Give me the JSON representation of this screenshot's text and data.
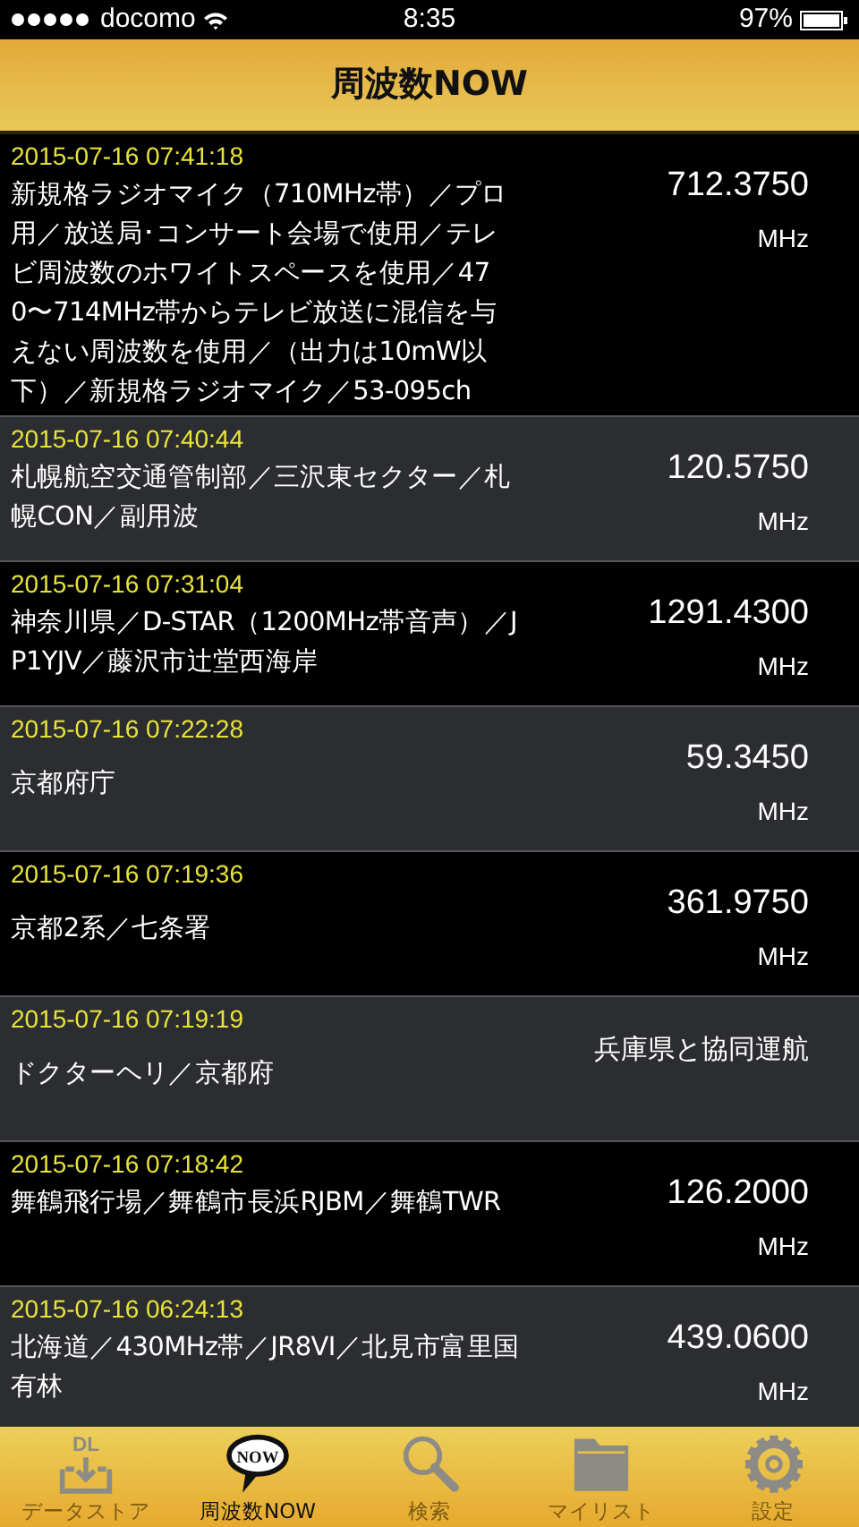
{
  "status_bar": {
    "carrier": "docomo",
    "time": "8:35",
    "battery": "97%"
  },
  "nav": {
    "title": "周波数NOW"
  },
  "entries": [
    {
      "timestamp": "2015-07-16 07:41:18",
      "description": "新規格ラジオマイク（710MHz帯）／プロ用／放送局･コンサート会場で使用／テレビ周波数のホワイトスペースを使用／470〜714MHz帯からテレビ放送に混信を与えない周波数を使用／（出力は10mW以下）／新規格ラジオマイク／53-095ch",
      "value": "712.3750",
      "unit": "MHz"
    },
    {
      "timestamp": "2015-07-16 07:40:44",
      "description": "札幌航空交通管制部／三沢東セクター／札幌CON／副用波",
      "value": "120.5750",
      "unit": "MHz"
    },
    {
      "timestamp": "2015-07-16 07:31:04",
      "description": "神奈川県／D-STAR（1200MHz帯音声）／JP1YJV／藤沢市辻堂西海岸",
      "value": "1291.4300",
      "unit": "MHz"
    },
    {
      "timestamp": "2015-07-16 07:22:28",
      "description": "京都府庁",
      "value": "59.3450",
      "unit": "MHz"
    },
    {
      "timestamp": "2015-07-16 07:19:36",
      "description": "京都2系／七条署",
      "value": "361.9750",
      "unit": "MHz"
    },
    {
      "timestamp": "2015-07-16 07:19:19",
      "description": "ドクターヘリ／京都府",
      "value": "兵庫県と協同運航"
    },
    {
      "timestamp": "2015-07-16 07:18:42",
      "description": "舞鶴飛行場／舞鶴市長浜RJBM／舞鶴TWR",
      "value": "126.2000",
      "unit": "MHz"
    },
    {
      "timestamp": "2015-07-16 06:24:13",
      "description": "北海道／430MHz帯／JR8VI／北見市富里国有林",
      "value": "439.0600",
      "unit": "MHz"
    }
  ],
  "tab_bar": [
    {
      "kind": "download",
      "icon_text": "DL",
      "label": "データストア",
      "selected": false
    },
    {
      "kind": "now",
      "icon_text": "NOW",
      "label": "周波数NOW",
      "selected": true
    },
    {
      "kind": "search",
      "label": "検索",
      "selected": false
    },
    {
      "kind": "folder",
      "label": "マイリスト",
      "selected": false
    },
    {
      "kind": "settings",
      "label": "設定",
      "selected": false
    }
  ]
}
